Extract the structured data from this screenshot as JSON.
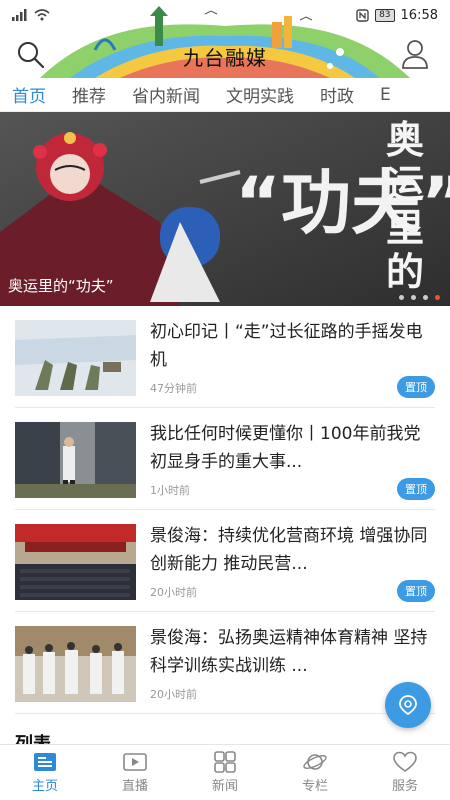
{
  "status_bar": {
    "battery": "83",
    "time": "16:58"
  },
  "header": {
    "title": "九台融媒"
  },
  "tabs": [
    {
      "label": "首页",
      "active": true
    },
    {
      "label": "推荐"
    },
    {
      "label": "省内新闻"
    },
    {
      "label": "文明实践"
    },
    {
      "label": "时政"
    },
    {
      "label": "E"
    }
  ],
  "hero": {
    "caption": "奥运里的“功夫”",
    "overlay_text": "“功夫”",
    "side_text": "奥运里的",
    "slide_count": 4,
    "active_slide": 4
  },
  "news": [
    {
      "title": "初心印记丨“走”过长征路的手摇发电机",
      "time": "47分钟前",
      "badge": "置顶"
    },
    {
      "title": "我比任何时候更懂你丨100年前我党初显身手的重大事...",
      "time": "1小时前",
      "badge": "置顶"
    },
    {
      "title": "景俊海：持续优化营商环境 增强协同创新能力 推动民营...",
      "time": "20小时前",
      "badge": "置顶"
    },
    {
      "title": "景俊海：弘扬奥运精神体育精神 坚持科学训练实战训练 ...",
      "time": "20小时前",
      "badge": ""
    }
  ],
  "section_peek": "列表",
  "bottom_nav": [
    {
      "label": "主页",
      "icon": "home-news-icon",
      "active": true
    },
    {
      "label": "直播",
      "icon": "live-video-icon"
    },
    {
      "label": "新闻",
      "icon": "grid-icon"
    },
    {
      "label": "专栏",
      "icon": "planet-icon"
    },
    {
      "label": "服务",
      "icon": "heart-icon"
    }
  ],
  "colors": {
    "accent": "#2d8ad8",
    "badge": "#3d9be3",
    "hero_dot_active": "#e8572a"
  }
}
